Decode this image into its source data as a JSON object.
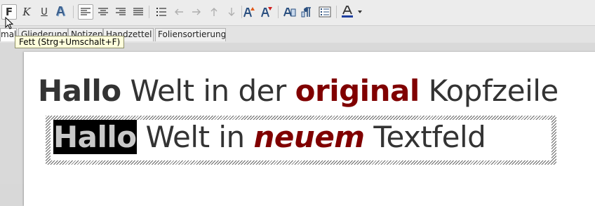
{
  "toolbar": {
    "bold_label": "F",
    "italic_label": "K",
    "underline_label": "U",
    "icons": [
      "bold-icon",
      "italic-icon",
      "underline-icon",
      "shadow-icon",
      "align-left-icon",
      "align-center-icon",
      "align-right-icon",
      "justify-icon",
      "bullet-list-icon",
      "arrow-left-icon",
      "arrow-right-icon",
      "arrow-up-icon",
      "arrow-down-icon",
      "increase-font-icon",
      "decrease-font-icon",
      "character-icon",
      "paragraph-icon",
      "bullets-numbering-icon",
      "font-color-icon",
      "dropdown-arrow-icon"
    ]
  },
  "tabs": [
    {
      "label": "Normal",
      "visible_text": "mal",
      "active": true
    },
    {
      "label": "Gliederung"
    },
    {
      "label": "Notizen"
    },
    {
      "label": "Handzettel"
    },
    {
      "label": "Foliensortierung"
    }
  ],
  "tooltip": {
    "text": "Fett (Strg+Umschalt+F)"
  },
  "slide": {
    "heading": {
      "part1": "Hallo",
      "part2": " Welt in der ",
      "part3": "original",
      "part4": " Kopfzeile"
    },
    "textbox": {
      "part1": "Hallo",
      "part2": " Welt in ",
      "part3": "neuem",
      "part4": " Textfeld"
    }
  },
  "colors": {
    "accent_red": "#800000",
    "text": "#333333",
    "selection": "#000000",
    "font_color_bar": "#1f3f9f"
  }
}
